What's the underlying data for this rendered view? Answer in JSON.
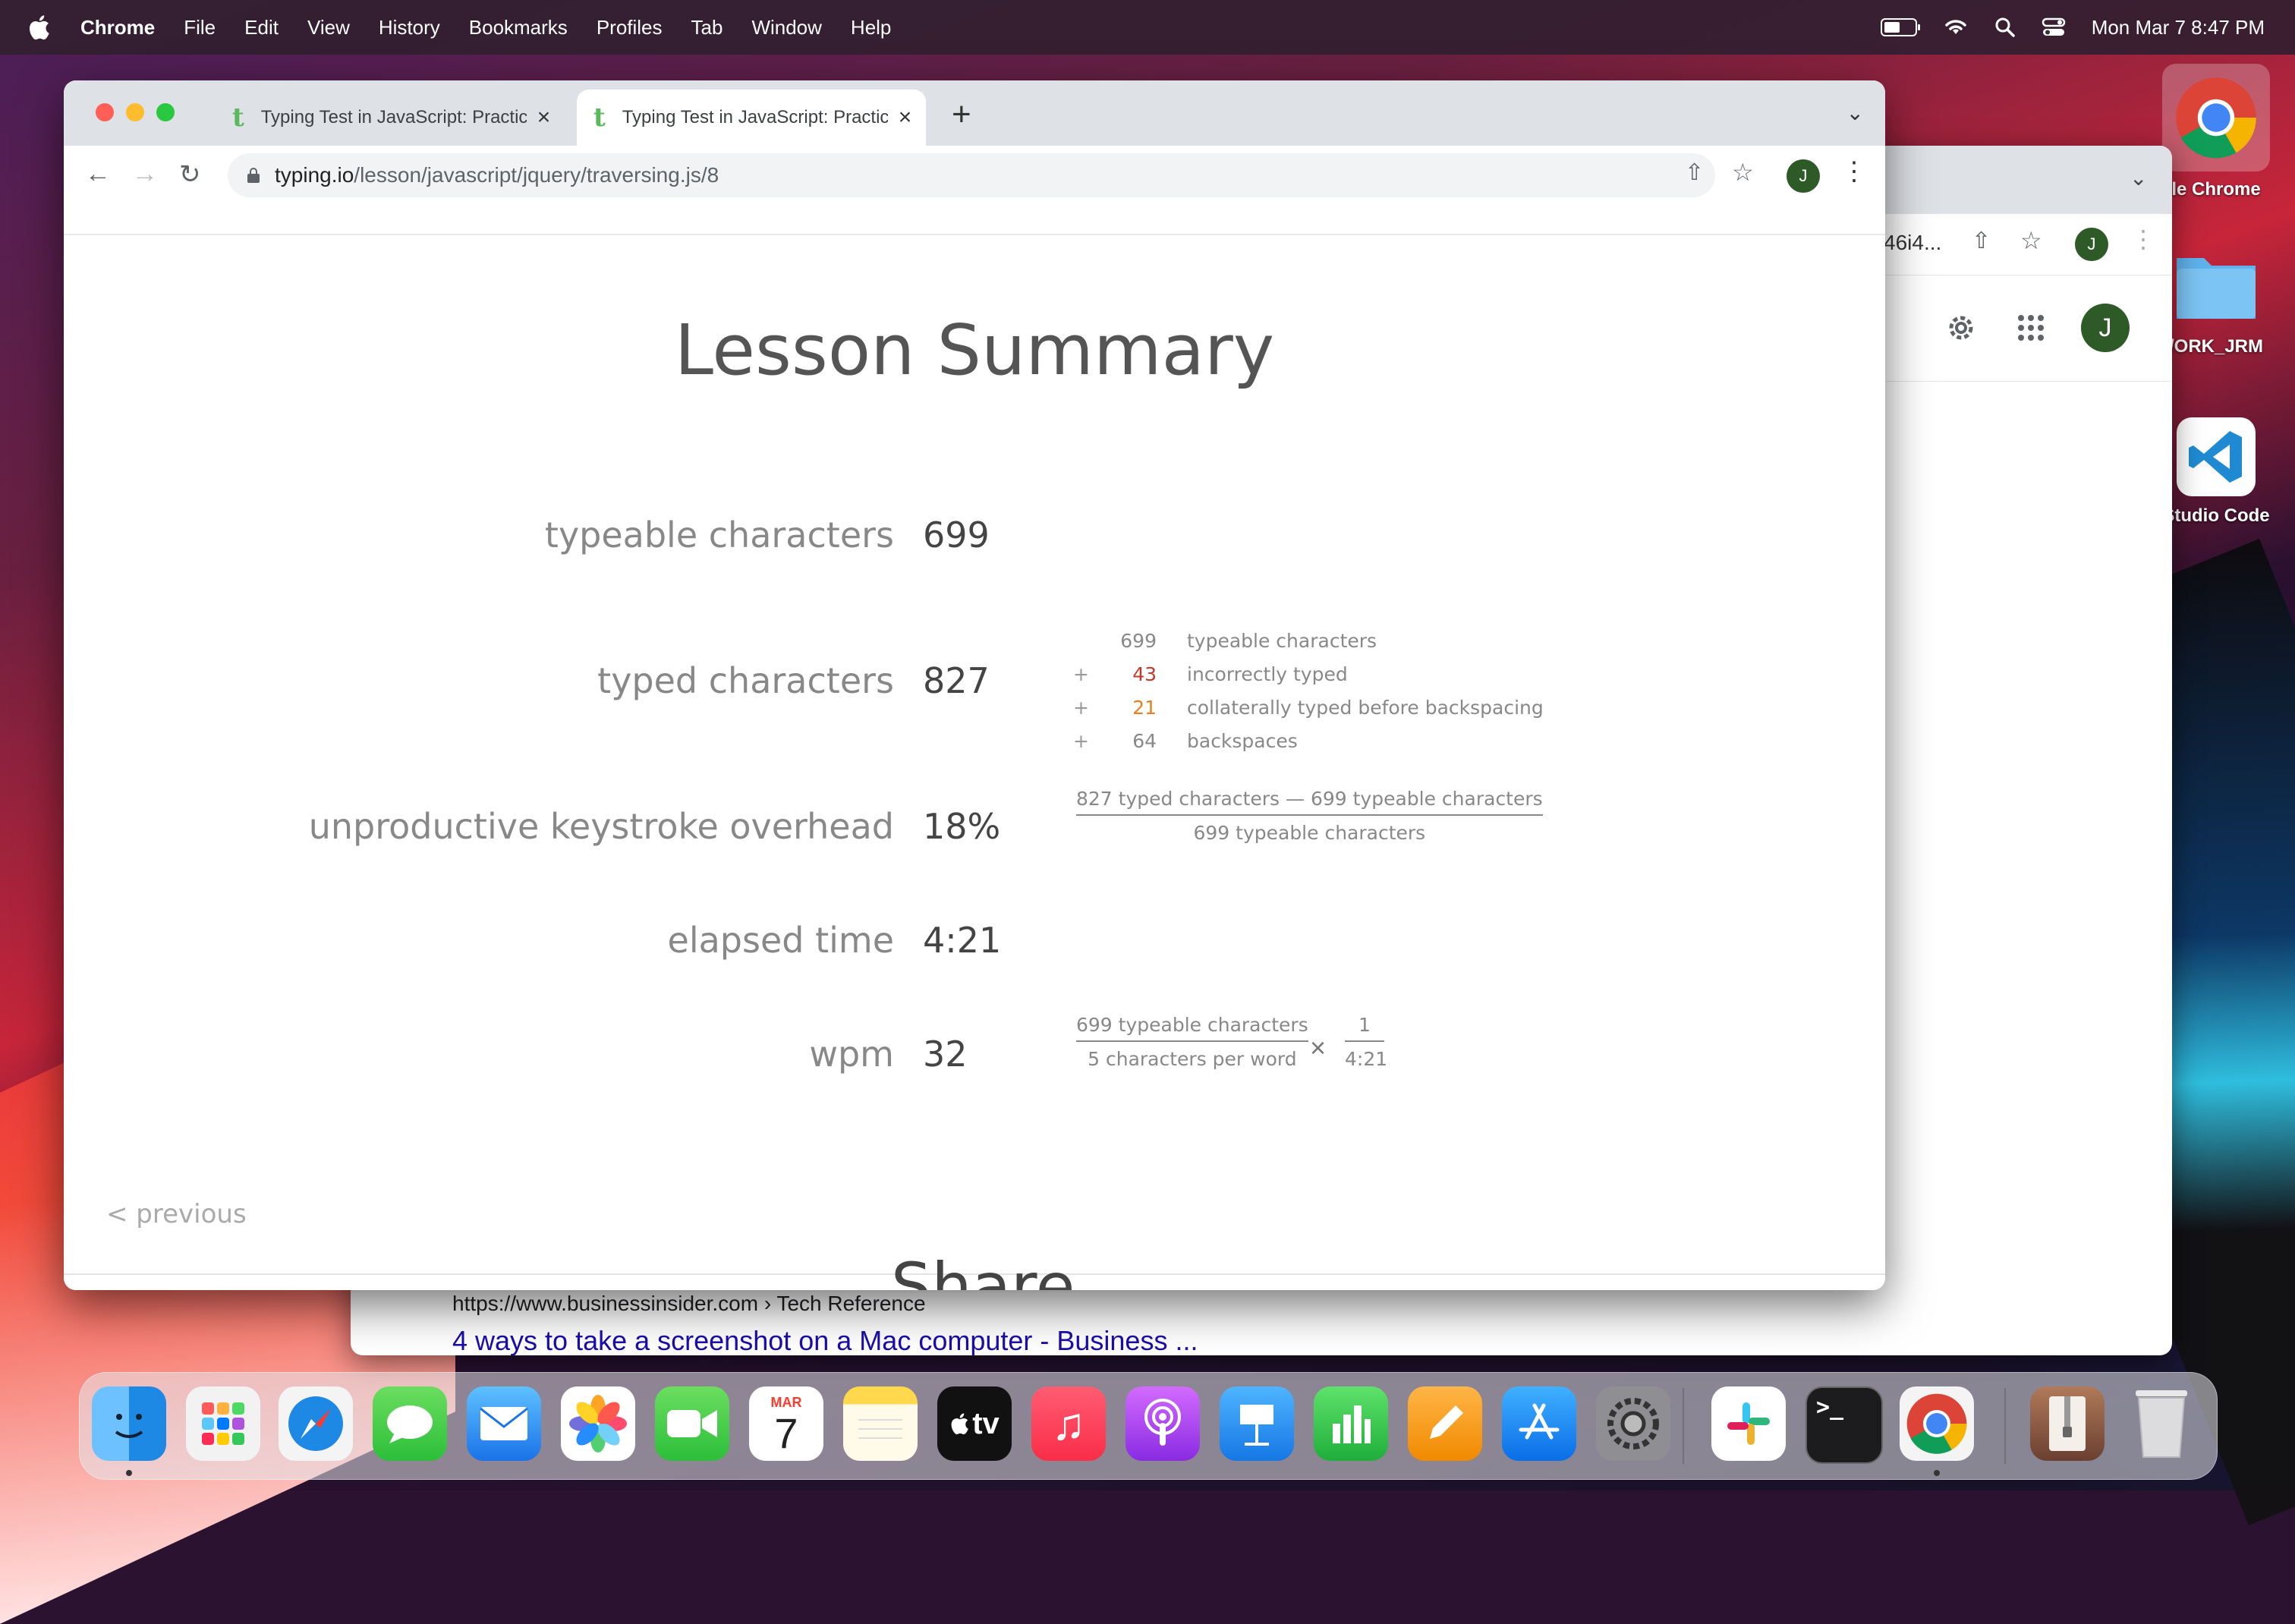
{
  "menubar": {
    "app_name": "Chrome",
    "items": [
      "File",
      "Edit",
      "View",
      "History",
      "Bookmarks",
      "Profiles",
      "Tab",
      "Window",
      "Help"
    ],
    "clock": "Mon Mar 7  8:47 PM"
  },
  "desktop": {
    "icons": [
      {
        "label": "le Chrome",
        "icon": "chrome-icon"
      },
      {
        "label": "/ORK_JRM",
        "icon": "folder-icon"
      },
      {
        "label": "Studio Code",
        "icon": "vscode-icon"
      }
    ]
  },
  "background_window": {
    "url_fragment": "46i4...",
    "avatar_letter": "J",
    "search_result": {
      "url": "https://www.businessinsider.com › Tech Reference",
      "title": "4 ways to take a screenshot on a Mac computer - Business ..."
    }
  },
  "browser": {
    "tabs": [
      {
        "favicon": "t",
        "title": "Typing Test in JavaScript: Practice",
        "active": false
      },
      {
        "favicon": "t",
        "title": "Typing Test in JavaScript: Practice",
        "active": true
      }
    ],
    "url_domain": "typing.io",
    "url_path": "/lesson/javascript/jquery/traversing.js/8",
    "avatar_letter": "J"
  },
  "summary": {
    "title": "Lesson Summary",
    "rows": {
      "typeable": {
        "label": "typeable characters",
        "value": "699"
      },
      "typed": {
        "label": "typed characters",
        "value": "827"
      },
      "overhead": {
        "label": "unproductive keystroke overhead",
        "value": "18%"
      },
      "elapsed": {
        "label": "elapsed time",
        "value": "4:21"
      },
      "wpm": {
        "label": "wpm",
        "value": "32"
      }
    },
    "breakdown": [
      {
        "plus": "",
        "num": "699",
        "text": "typeable characters",
        "color": "#888888"
      },
      {
        "plus": "+",
        "num": "43",
        "text": "incorrectly typed",
        "color": "#c0392b"
      },
      {
        "plus": "+",
        "num": "21",
        "text": "collaterally typed before backspacing",
        "color": "#e67e22"
      },
      {
        "plus": "+",
        "num": "64",
        "text": "backspaces",
        "color": "#888888"
      }
    ],
    "overhead_fraction": {
      "numerator": "827 typed characters — 699 typeable characters",
      "denominator": "699 typeable characters"
    },
    "wpm_fraction": {
      "left_numerator": "699 typeable characters",
      "left_denominator": "5 characters per word",
      "times": "×",
      "right_numerator": "1",
      "right_denominator": "4:21"
    },
    "previous_link": "< previous",
    "share_heading": "Share"
  },
  "dock": {
    "apps": [
      "Finder",
      "Launchpad",
      "Safari",
      "Messages",
      "Mail",
      "Photos",
      "FaceTime",
      "Calendar",
      "Notes",
      "TV",
      "Music",
      "Podcasts",
      "Keynote",
      "Numbers",
      "Pages",
      "App Store",
      "System Preferences",
      "Slack",
      "Terminal",
      "Chrome",
      "Archive",
      "Trash"
    ],
    "calendar_month": "MAR",
    "calendar_day": "7",
    "tv_label": "tv"
  }
}
